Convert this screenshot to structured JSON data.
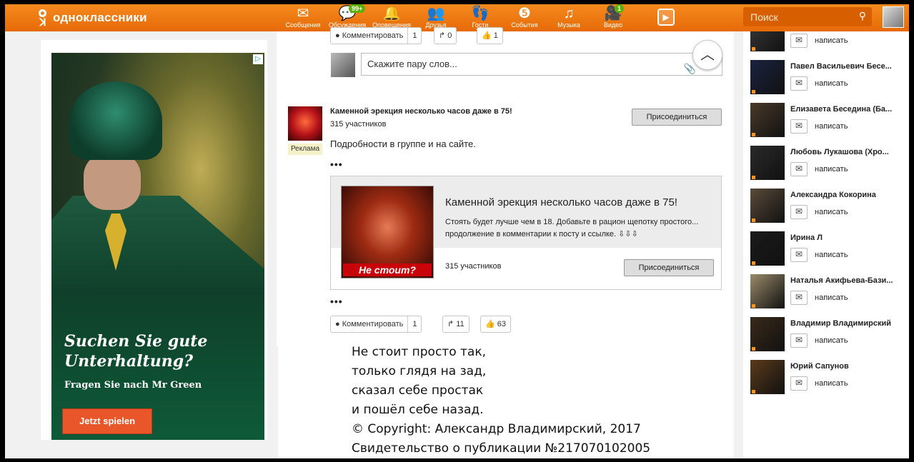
{
  "header": {
    "logo_text": "одноклассники",
    "nav": [
      {
        "label": "Сообщения",
        "icon": "envelope-icon",
        "glyph": "✉",
        "badge": ""
      },
      {
        "label": "Обсуждения",
        "icon": "discussions-icon",
        "glyph": "💬",
        "badge": "99+"
      },
      {
        "label": "Оповещения",
        "icon": "bell-icon",
        "glyph": "🔔",
        "badge": ""
      },
      {
        "label": "Друзья",
        "icon": "friends-icon",
        "glyph": "👥",
        "badge": ""
      },
      {
        "label": "Гости",
        "icon": "footprints-icon",
        "glyph": "👣",
        "badge": ""
      },
      {
        "label": "События",
        "icon": "events-icon",
        "glyph": "❺",
        "badge": ""
      },
      {
        "label": "Музыка",
        "icon": "music-note-icon",
        "glyph": "♫",
        "badge": ""
      },
      {
        "label": "Видео",
        "icon": "video-camera-icon",
        "glyph": "🎥",
        "badge": "1"
      }
    ],
    "search_placeholder": "Поиск"
  },
  "ad": {
    "headline": "Suchen Sie gute Unterhaltung?",
    "subline": "Fragen Sie nach Mr Green",
    "cta": "Jetzt spielen"
  },
  "post1": {
    "comment_label": "Комментировать",
    "comment_count": "1",
    "share_count": "0",
    "like_count": "1",
    "input_placeholder": "Скажите пару слов..."
  },
  "post2": {
    "group_title": "Каменной эрекция несколько часов даже в 75!",
    "members": "315 участников",
    "join_label": "Присоединиться",
    "ad_tag": "Реклама",
    "text": "Подробности в группе и на сайте.",
    "dots": "•••",
    "inner_title": "Каменной эрекция несколько часов даже в 75!",
    "inner_desc": "Стоять будет лучше чем в 18. Добавьте в рацион щепотку простого... продолжение в комментарии к посту и ссылке. ⇩⇩⇩",
    "image_caption": "Не стоит?",
    "inner_members": "315 участников",
    "inner_join": "Присоединиться",
    "comment_label": "Комментировать",
    "comment_count": "1",
    "share_count": "11",
    "like_count": "63"
  },
  "poem": "Не стоит просто так,\nтолько глядя на зад,\nсказал себе простак\nи пошёл себе назад.\n© Copyright: Александр Владимирский, 2017\nСвидетельство о публикации №217070102005",
  "friends": [
    {
      "name": "",
      "write": "написать",
      "color": "#3a3a3a"
    },
    {
      "name": "Павел Васильевич Бесе...",
      "write": "написать",
      "color": "#1a2340"
    },
    {
      "name": "Елизавета Беседина (Ба...",
      "write": "написать",
      "color": "#4a3a2a"
    },
    {
      "name": "Любовь Лукашова (Хро...",
      "write": "написать",
      "color": "#2a2a2a"
    },
    {
      "name": "Александра Кокорина",
      "write": "написать",
      "color": "#5a4a3a"
    },
    {
      "name": "Ирина Л",
      "write": "написать",
      "color": "#1a1a1a"
    },
    {
      "name": "Наталья Акифьева-Бази...",
      "write": "написать",
      "color": "#9a8a6a"
    },
    {
      "name": "Владимир Владимирский",
      "write": "написать",
      "color": "#3a2a1a"
    },
    {
      "name": "Юрий Сапунов",
      "write": "написать",
      "color": "#5a3a1a"
    }
  ]
}
